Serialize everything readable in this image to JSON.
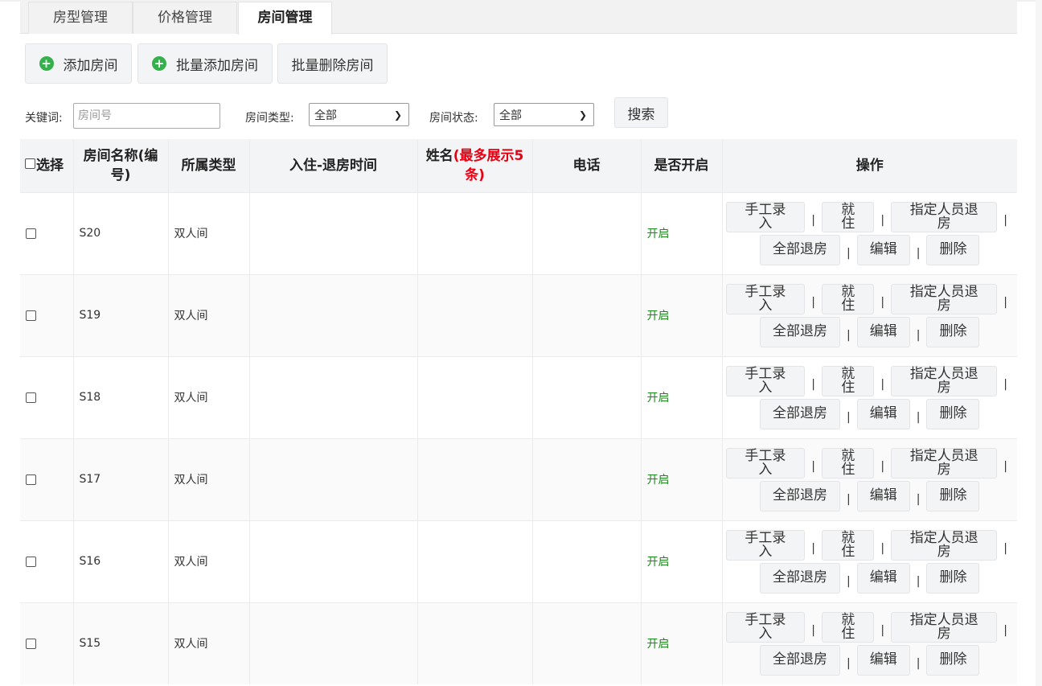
{
  "tabs": [
    {
      "label": "房型管理"
    },
    {
      "label": "价格管理"
    },
    {
      "label": "房间管理"
    }
  ],
  "toolbar": {
    "add_room": "添加房间",
    "batch_add": "批量添加房间",
    "batch_delete": "批量删除房间"
  },
  "search": {
    "keyword_label": "关键词:",
    "keyword_placeholder": "房间号",
    "type_label": "房间类型:",
    "type_value": "全部",
    "status_label": "房间状态:",
    "status_value": "全部",
    "search_button": "搜索"
  },
  "table": {
    "headers": {
      "select": "选择",
      "name_line1": "房间名称(编",
      "name_line2": "号)",
      "type": "所属类型",
      "time": "入住-退房时间",
      "guest_prefix": "姓名",
      "guest_red1": "(最多展示5",
      "guest_red2": "条)",
      "phone": "电话",
      "enabled": "是否开启",
      "ops": "操作"
    },
    "actions": {
      "manual": "手工录入",
      "checkin": "就住",
      "assign_checkout": "指定人员退房",
      "checkout_all": "全部退房",
      "edit": "编辑",
      "delete": "删除",
      "sep": "|"
    },
    "rows": [
      {
        "name": "S20",
        "type": "双人间",
        "time": "",
        "guest": "",
        "phone": "",
        "enabled": "开启"
      },
      {
        "name": "S19",
        "type": "双人间",
        "time": "",
        "guest": "",
        "phone": "",
        "enabled": "开启"
      },
      {
        "name": "S18",
        "type": "双人间",
        "time": "",
        "guest": "",
        "phone": "",
        "enabled": "开启"
      },
      {
        "name": "S17",
        "type": "双人间",
        "time": "",
        "guest": "",
        "phone": "",
        "enabled": "开启"
      },
      {
        "name": "S16",
        "type": "双人间",
        "time": "",
        "guest": "",
        "phone": "",
        "enabled": "开启"
      },
      {
        "name": "S15",
        "type": "双人间",
        "time": "",
        "guest": "",
        "phone": "",
        "enabled": "开启"
      }
    ]
  },
  "colors": {
    "accent_green": "#36b04c",
    "status_green": "#1a8a1a",
    "note_red": "#e60012"
  }
}
